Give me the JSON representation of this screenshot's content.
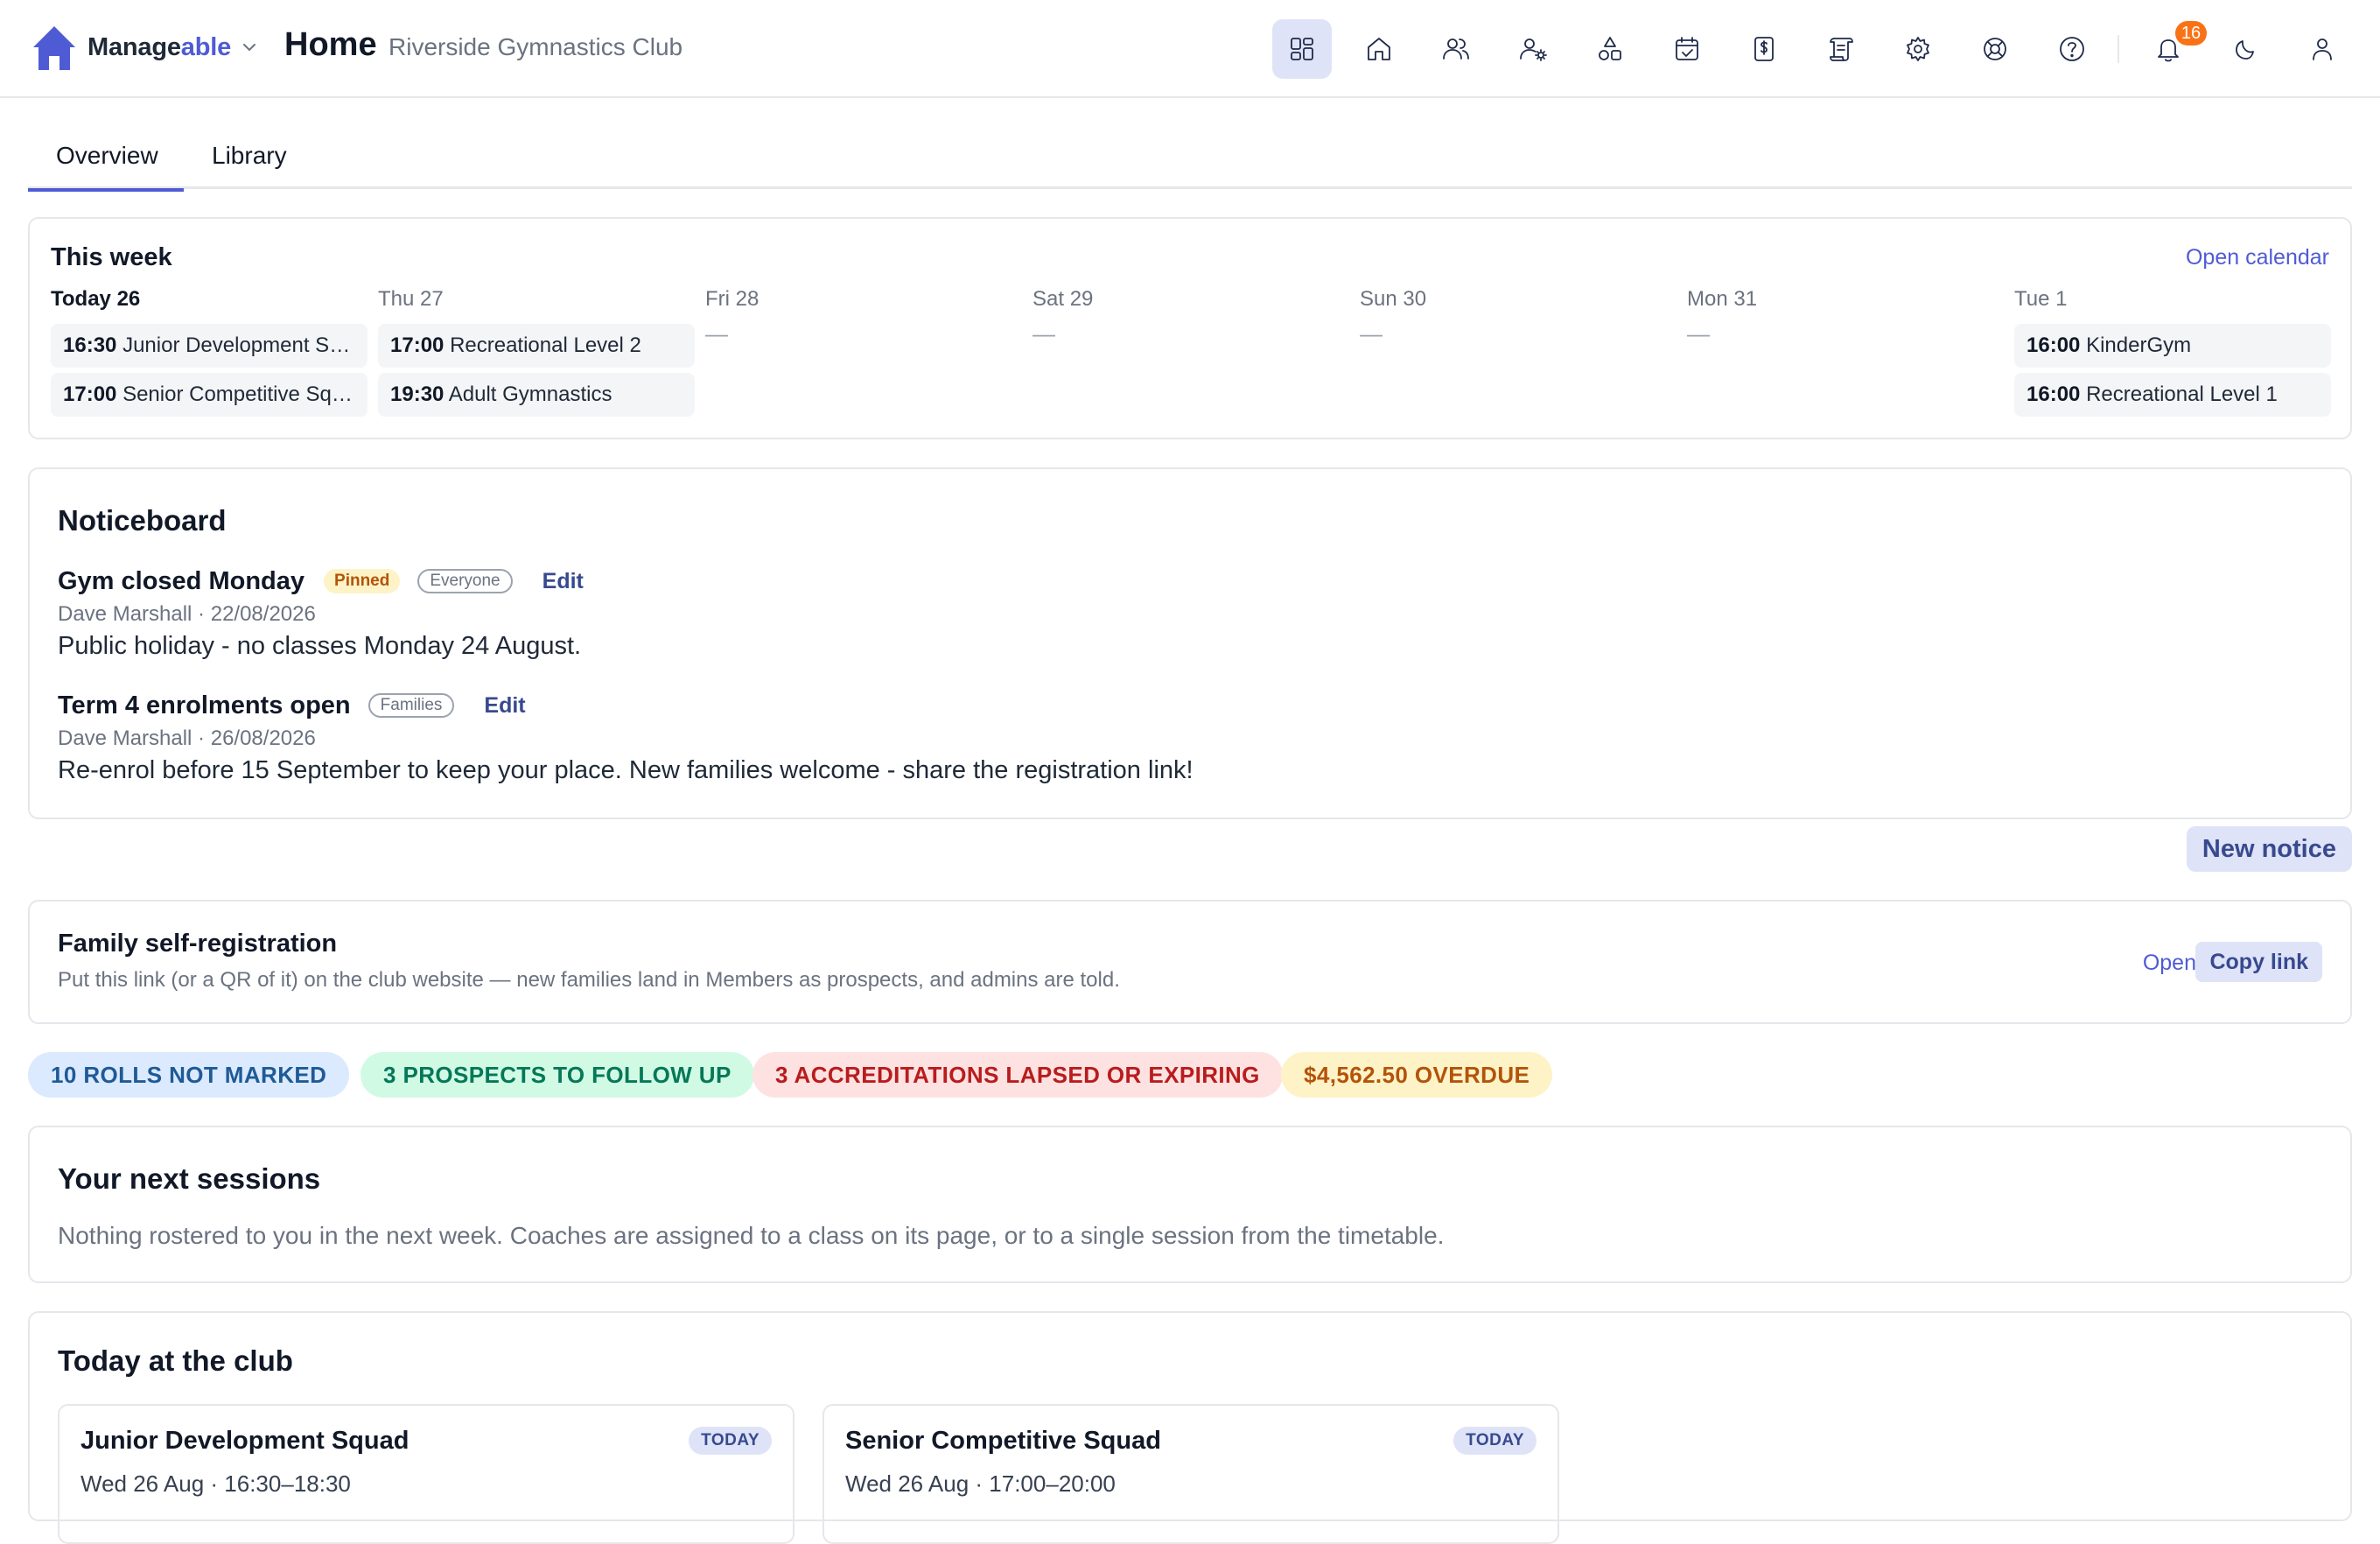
{
  "brand": {
    "name_part1": "Manage",
    "name_part2": "able"
  },
  "header": {
    "title": "Home",
    "club": "Riverside Gymnastics Club",
    "notification_count": "16"
  },
  "nav_icons": [
    "dashboard-icon",
    "home-icon",
    "members-icon",
    "coach-settings-icon",
    "classes-icon",
    "calendar-check-icon",
    "billing-icon",
    "scroll-icon",
    "gear-icon",
    "help-buoy-icon",
    "question-icon",
    "bell-icon",
    "moon-icon",
    "user-icon"
  ],
  "tabs": [
    "Overview",
    "Library"
  ],
  "week": {
    "title": "This week",
    "open_calendar": "Open calendar",
    "days": [
      {
        "label": "Today 26",
        "events": [
          {
            "time": "16:30",
            "name": "Junior Development Squad"
          },
          {
            "time": "17:00",
            "name": "Senior Competitive Squad"
          }
        ]
      },
      {
        "label": "Thu 27",
        "events": [
          {
            "time": "17:00",
            "name": "Recreational Level 2"
          },
          {
            "time": "19:30",
            "name": "Adult Gymnastics"
          }
        ]
      },
      {
        "label": "Fri 28",
        "empty": "—"
      },
      {
        "label": "Sat 29",
        "empty": "—"
      },
      {
        "label": "Sun 30",
        "empty": "—"
      },
      {
        "label": "Mon 31",
        "empty": "—"
      },
      {
        "label": "Tue 1",
        "events": [
          {
            "time": "16:00",
            "name": "KinderGym"
          },
          {
            "time": "16:00",
            "name": "Recreational Level 1"
          }
        ]
      }
    ]
  },
  "noticeboard": {
    "title": "Noticeboard",
    "notices": [
      {
        "title": "Gym closed Monday",
        "pinned": "Pinned",
        "audience": "Everyone",
        "edit": "Edit",
        "meta": "Dave Marshall · 22/08/2026",
        "body": "Public holiday - no classes Monday 24 August."
      },
      {
        "title": "Term 4 enrolments open",
        "audience": "Families",
        "edit": "Edit",
        "meta": "Dave Marshall · 26/08/2026",
        "body": "Re-enrol before 15 September to keep your place. New families welcome - share the registration link!"
      }
    ],
    "new_notice": "New notice"
  },
  "registration": {
    "title": "Family self-registration",
    "desc": "Put this link (or a QR of it) on the club website — new families land in Members as prospects, and admins are told.",
    "open": "Open",
    "copy": "Copy link"
  },
  "alerts": [
    {
      "text": "10 ROLLS NOT MARKED",
      "bg": "#dbeafe",
      "fg": "#1e5a96"
    },
    {
      "text": "3 PROSPECTS TO FOLLOW UP",
      "bg": "#d1fae5",
      "fg": "#047857"
    },
    {
      "text": "3 ACCREDITATIONS LAPSED OR EXPIRING",
      "bg": "#fee2e2",
      "fg": "#b91c1c"
    },
    {
      "text": "$4,562.50 OVERDUE",
      "bg": "#fef3c7",
      "fg": "#b45309"
    }
  ],
  "next_sessions": {
    "title": "Your next sessions",
    "empty": "Nothing rostered to you in the next week. Coaches are assigned to a class on its page, or to a single session from the timetable."
  },
  "today": {
    "title": "Today at the club",
    "classes": [
      {
        "name": "Junior Development Squad",
        "badge": "TODAY",
        "when": "Wed 26 Aug · 16:30–18:30"
      },
      {
        "name": "Senior Competitive Squad",
        "badge": "TODAY",
        "when": "Wed 26 Aug · 17:00–20:00"
      }
    ]
  }
}
